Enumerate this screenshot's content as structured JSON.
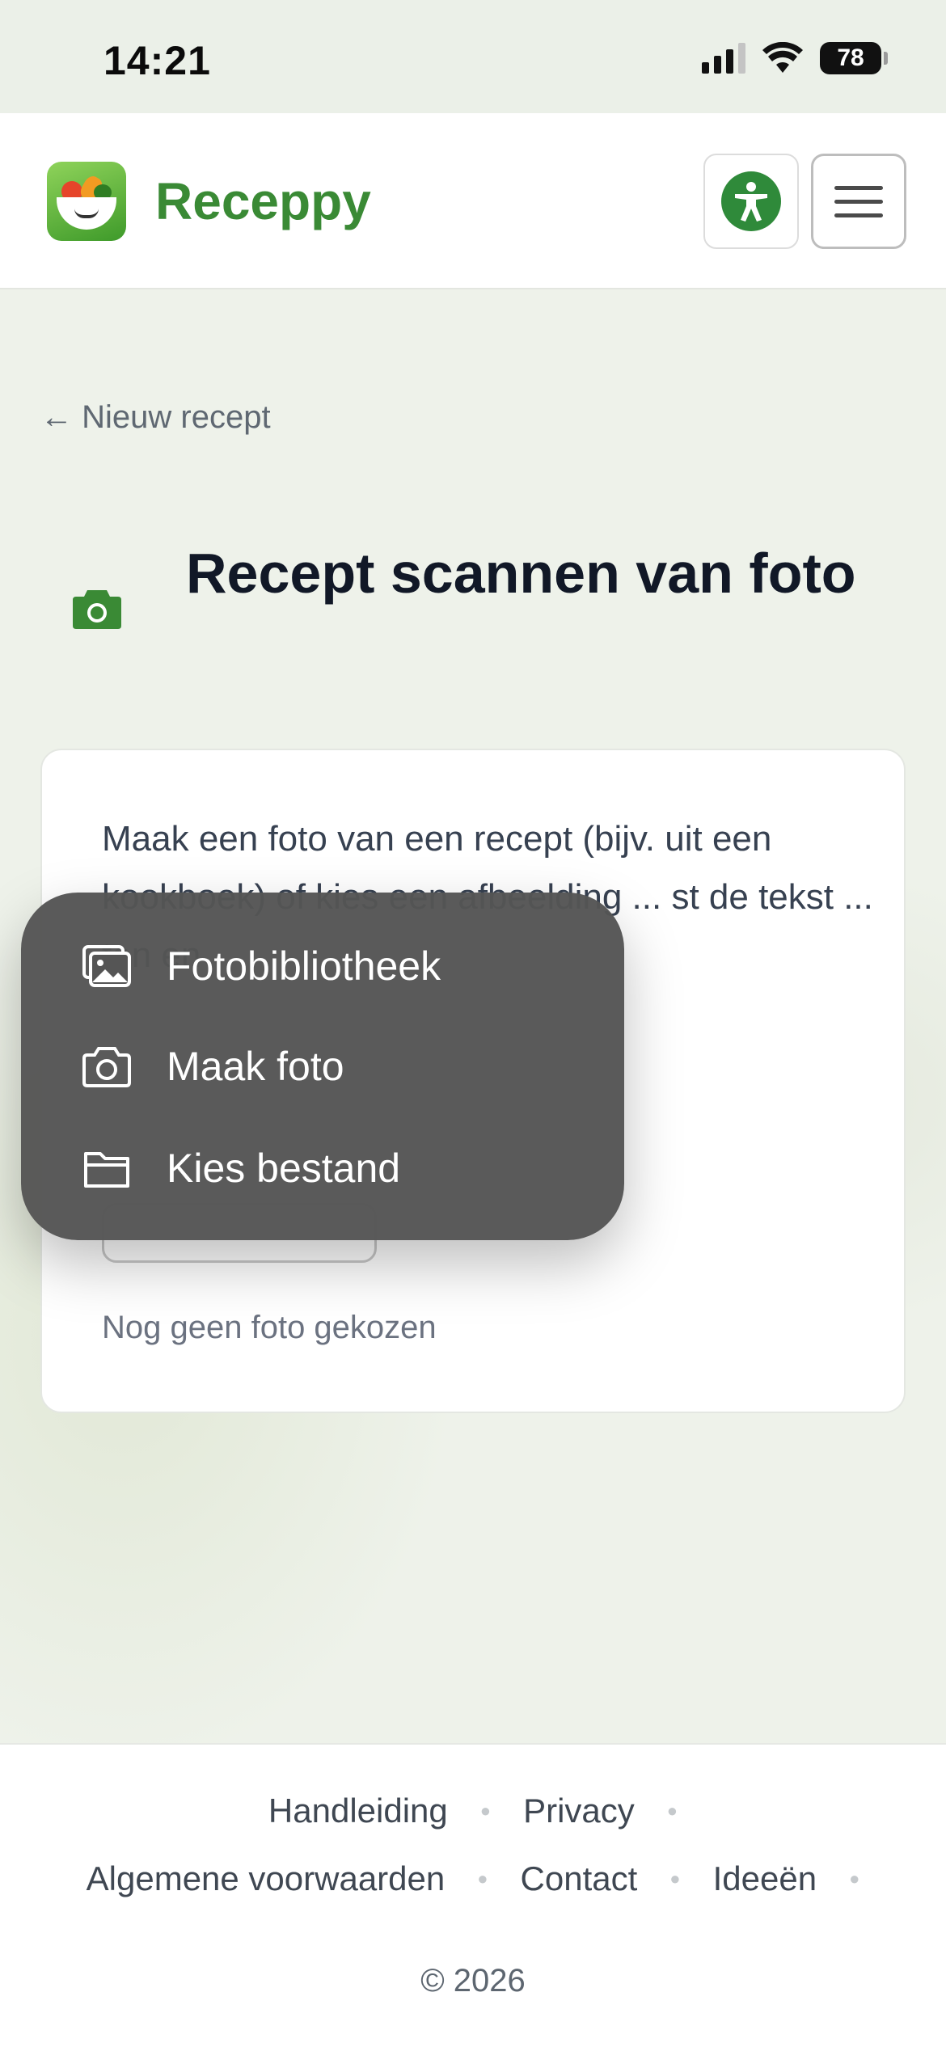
{
  "status_bar": {
    "time": "14:21",
    "battery": "78"
  },
  "header": {
    "brand": "Receppy"
  },
  "nav": {
    "back_link": "← Nieuw recept"
  },
  "page": {
    "title": "Recept scannen van foto"
  },
  "card": {
    "description": "Maak een foto van een recept (bijv. uit een kookboek) of kies een afbeelding ... st de tekst ... ten en",
    "status": "Nog geen foto gekozen"
  },
  "popup": {
    "items": [
      {
        "label": "Fotobibliotheek",
        "icon": "photo-library-icon"
      },
      {
        "label": "Maak foto",
        "icon": "camera-icon"
      },
      {
        "label": "Kies bestand",
        "icon": "folder-icon"
      }
    ]
  },
  "footer": {
    "links": [
      "Handleiding",
      "Privacy",
      "Algemene voorwaarden",
      "Contact",
      "Ideeën"
    ],
    "copyright": "© 2026"
  },
  "colors": {
    "brand": "#3a8a35",
    "accent": "#2f8a3a",
    "popup_bg": "#555555"
  }
}
